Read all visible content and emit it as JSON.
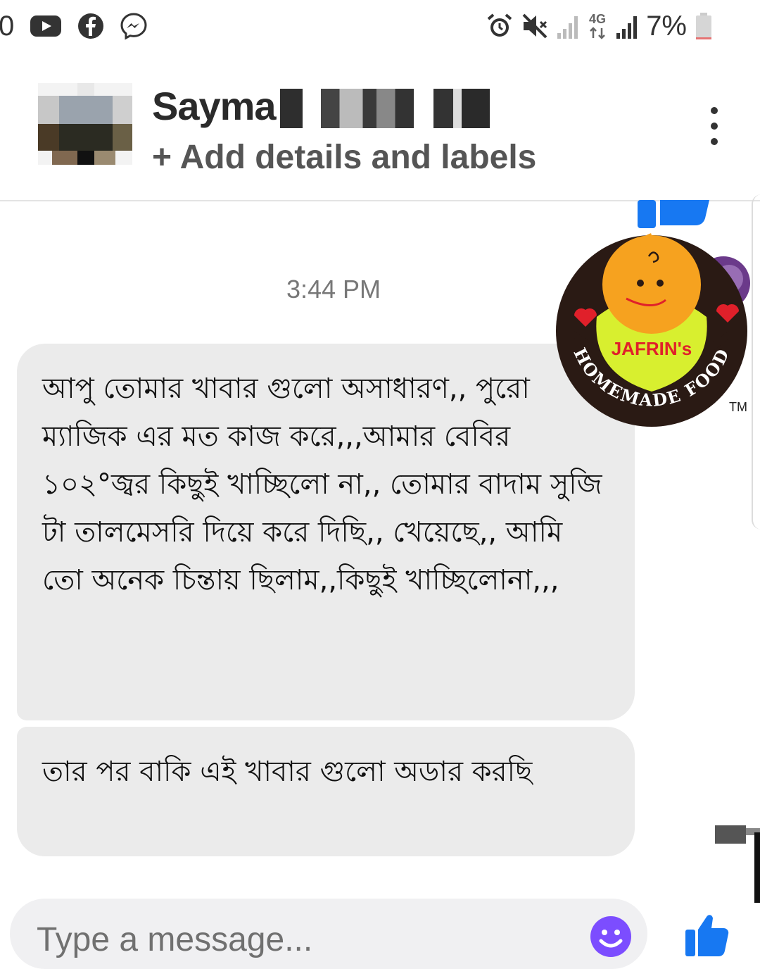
{
  "status_bar": {
    "left_number": "0",
    "left_icons": [
      "youtube-icon",
      "facebook-icon",
      "messenger-icon"
    ],
    "right_icons": [
      "alarm-icon",
      "mute-icon",
      "signal-weak-icon",
      "network-4g-icon",
      "signal-icon"
    ],
    "network_label": "4G",
    "battery_percent": "7%",
    "battery_level": 0.07,
    "battery_color": "#e57373"
  },
  "header": {
    "contact_name": "Sayma",
    "details_link": "+ Add details and labels",
    "menu_icon": "more-vertical-icon"
  },
  "conversation": {
    "timestamp": "3:44 PM",
    "messages": [
      {
        "text": "আপু তোমার খাবার গুলো অসাধারণ,, পুরো ম্যাজিক এর মত কাজ করে,,,আমার বেবির ১০২°জ্বর কিছুই খাচ্ছিলো না,, তোমার বাদাম সুজি টা তালমেসরি দিয়ে করে দিছি,, খেয়েছে,, আমি তো অনেক চিন্তায় ছিলাম,,কিছুই খাচ্ছিলোনা,,,"
      },
      {
        "text": "তার পর বাকি এই খাবার গুলো অডার করছি"
      }
    ]
  },
  "logo": {
    "brand": "JAFRIN's",
    "arc_text": "HOMEMADE FOOD",
    "trademark": "TM",
    "colors": {
      "ring": "#2a1a14",
      "bib": "#d8ef2f",
      "face": "#f6a21f",
      "heart": "#e0202a"
    }
  },
  "composer": {
    "placeholder": "Type a message...",
    "emoji_icon": "smiley-icon",
    "like_icon": "thumbs-up-icon",
    "accent_color": "#1778f2",
    "emoji_color": "#7c4dff"
  }
}
